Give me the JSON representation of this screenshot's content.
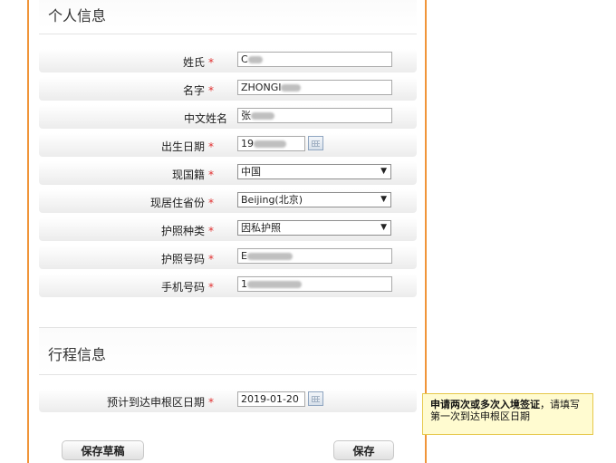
{
  "personal": {
    "title": "个人信息",
    "fields": {
      "surname": {
        "label": "姓氏",
        "value": "C"
      },
      "given_name": {
        "label": "名字",
        "value": "ZHONGI"
      },
      "chinese_name": {
        "label": "中文姓名",
        "value": "张"
      },
      "birth_date": {
        "label": "出生日期",
        "value": "19"
      },
      "nationality": {
        "label": "现国籍",
        "value": "中国"
      },
      "province": {
        "label": "现居住省份",
        "value": "Beijing(北京)"
      },
      "passport_type": {
        "label": "护照种类",
        "value": "因私护照"
      },
      "passport_number": {
        "label": "护照号码",
        "value": "E"
      },
      "mobile": {
        "label": "手机号码",
        "value": "1"
      }
    }
  },
  "trip": {
    "title": "行程信息",
    "arrival": {
      "label": "预计到达申根区日期",
      "value": "2019-01-20"
    }
  },
  "required_mark": "*",
  "buttons": {
    "save_draft": "保存草稿",
    "save": "保存"
  },
  "tooltip": {
    "bold": "申请两次或多次入境签证",
    "text": "，请填写第一次到达申根区日期"
  }
}
